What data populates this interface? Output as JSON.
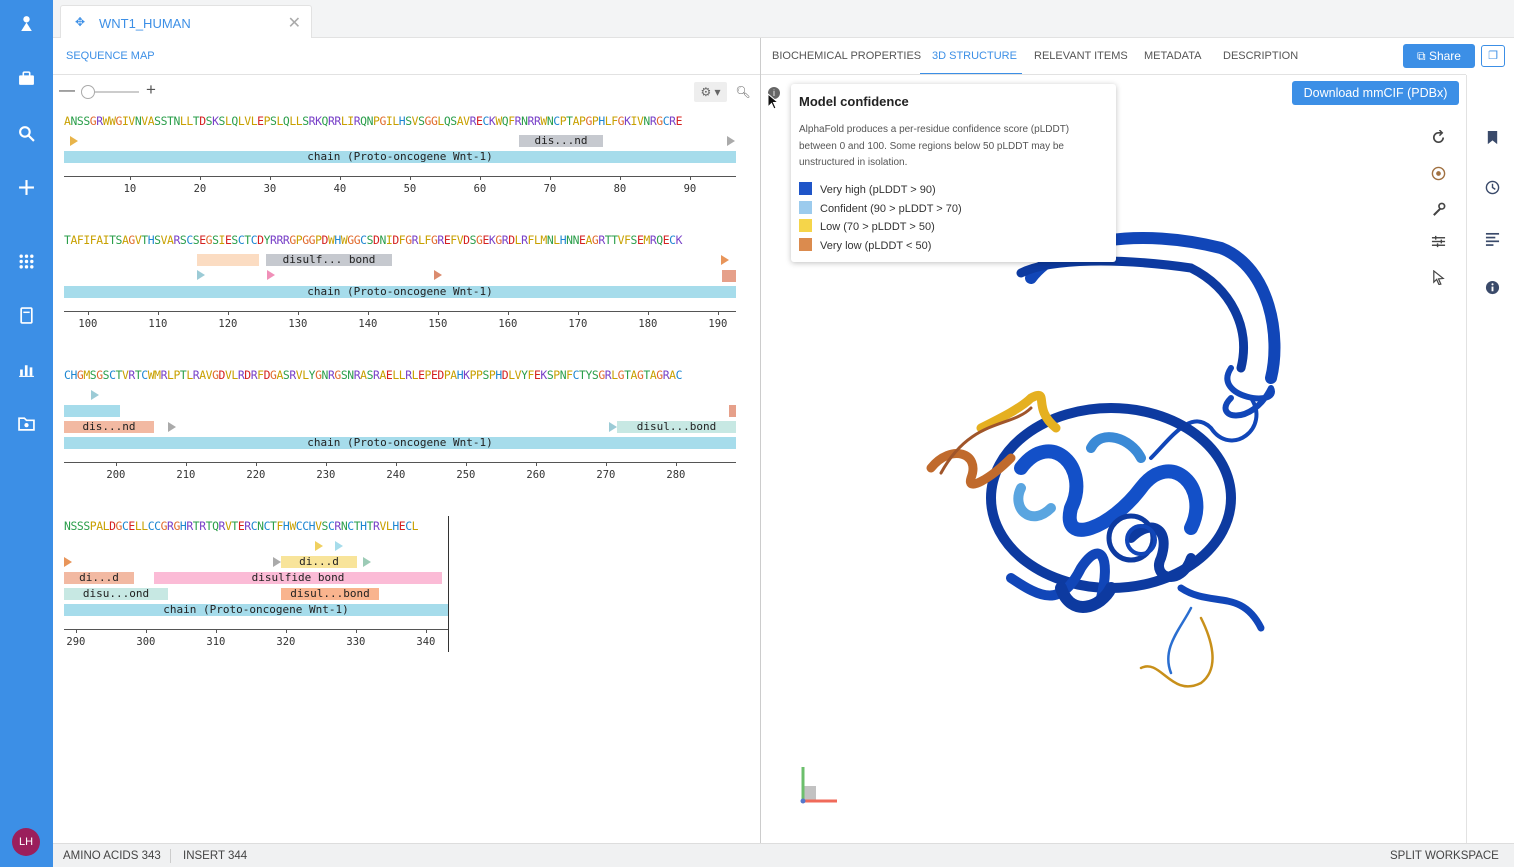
{
  "doc_tab": {
    "title": "WNT1_HUMAN",
    "close": "✕"
  },
  "left_panel": {
    "tab": "SEQUENCE MAP",
    "rows": [
      {
        "sequence": "ANSSGRWWGIVNVASSTNLLTDSKSLQLVLEPSLQLLSRKQRRLIRQNPGILHSVSGGLQSAVRECKWQFRNRRWNCPTAPGPHLFGKIVNRGCRE",
        "features": [
          {
            "label": "dis...nd",
            "color": "#c6c9cf"
          },
          {
            "label": "chain (Proto-oncogene Wnt-1)",
            "color": "#a6dceb"
          }
        ],
        "ticks": [
          "10",
          "20",
          "30",
          "40",
          "50",
          "60",
          "70",
          "80",
          "90"
        ]
      },
      {
        "sequence": "TAFIFAITSAGVTHSVARSCSEGSIESCTCDYRRRGPGGPDWHWGGCSDNIDFGRLFGREFVDSGEKGRDLRFLMNLHNNEAGRTTVFSEMRQECK",
        "features": [
          {
            "label": "",
            "color": "#fbdcc2"
          },
          {
            "label": "disulf... bond",
            "color": "#c6c9cf"
          },
          {
            "label": "chain (Proto-oncogene Wnt-1)",
            "color": "#a6dceb"
          }
        ],
        "ticks": [
          "100",
          "110",
          "120",
          "130",
          "140",
          "150",
          "160",
          "170",
          "180",
          "190"
        ]
      },
      {
        "sequence": "CHGMSGSCTVRTCWMRLPTLRAVGDVLRDRFDGASRVLYGNRGSNRASRAELLRLEPEDPAHKPPSPHDLVYFEKSPNFCTYSGRLGTAGTAGRAC",
        "features": [
          {
            "label": "",
            "color": "#a6dceb"
          },
          {
            "label": "dis...nd",
            "color": "#f2b9a2"
          },
          {
            "label": "disul...bond",
            "color": "#c7e8e3"
          },
          {
            "label": "chain (Proto-oncogene Wnt-1)",
            "color": "#a6dceb"
          }
        ],
        "ticks": [
          "200",
          "210",
          "220",
          "230",
          "240",
          "250",
          "260",
          "270",
          "280"
        ]
      },
      {
        "sequence": "NSSSPALDGCELLCCGRGHRTRTQRVTERCNCTFHWCCHVSCRNCTHTRVLHECL",
        "features": [
          {
            "label": "di...d",
            "color": "#f8e49a"
          },
          {
            "label": "di...d",
            "color": "#f2b9a2"
          },
          {
            "label": "disulfide bond",
            "color": "#fbbbd6"
          },
          {
            "label": "disu...ond",
            "color": "#c7e8e3"
          },
          {
            "label": "disul...bond",
            "color": "#f9b48e"
          },
          {
            "label": "chain (Proto-oncogene Wnt-1)",
            "color": "#a6dceb"
          }
        ],
        "ticks": [
          "290",
          "300",
          "310",
          "320",
          "330",
          "340"
        ]
      }
    ]
  },
  "right_panel": {
    "tabs": [
      "BIOCHEMICAL PROPERTIES",
      "3D STRUCTURE",
      "RELEVANT ITEMS",
      "METADATA",
      "DESCRIPTION"
    ],
    "active_tab": "3D STRUCTURE",
    "share_label": "Share",
    "download_label": "Download mmCIF (PDBx)",
    "popover": {
      "title": "Model confidence",
      "description": "AlphaFold produces a per-residue confidence score (pLDDT) between 0 and 100. Some regions below 50 pLDDT may be unstructured in isolation.",
      "legend": [
        {
          "label": "Very high (pLDDT > 90)",
          "color": "#1f55c8"
        },
        {
          "label": "Confident (90 > pLDDT > 70)",
          "color": "#9ccbed"
        },
        {
          "label": "Low (70 > pLDDT > 50)",
          "color": "#f5d54a"
        },
        {
          "label": "Very low (pLDDT < 50)",
          "color": "#db8b4e"
        }
      ]
    }
  },
  "status_bar": {
    "amino_acids": "AMINO ACIDS 343",
    "insert": "INSERT 344",
    "workspace": "SPLIT WORKSPACE"
  },
  "colors": {
    "accent": "#3c8fe6",
    "nav_bg": "#3c8fe6"
  }
}
